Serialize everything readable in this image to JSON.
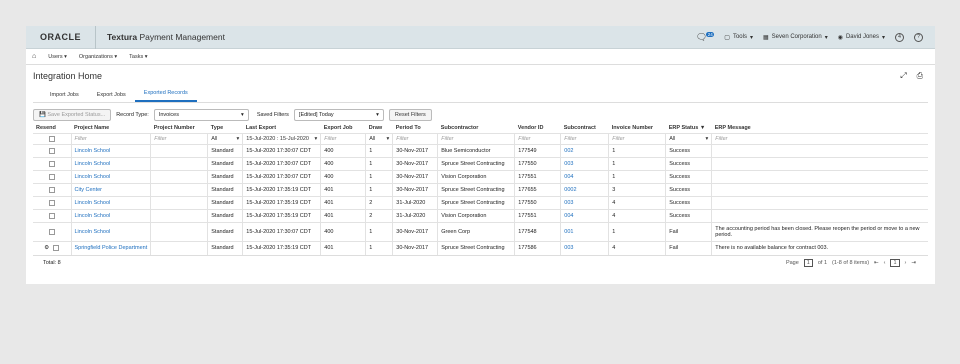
{
  "topbar": {
    "logo": "ORACLE",
    "app_name_bold": "Textura",
    "app_name_rest": " Payment Management",
    "notif_count": "24",
    "tools": "Tools",
    "company": "Seven Corporation",
    "user": "David Jones",
    "bell_count": "4",
    "help": "?"
  },
  "menubar": {
    "users": "Users",
    "organizations": "Organizations",
    "tasks": "Tasks"
  },
  "page": {
    "title": "Integration Home"
  },
  "tabs": [
    {
      "label": "Import Jobs"
    },
    {
      "label": "Export Jobs"
    },
    {
      "label": "Exported Records"
    }
  ],
  "toolbar": {
    "save_status": "Save Exported Status...",
    "record_type_label": "Record Type:",
    "record_type_value": "Invoices",
    "saved_filters_label": "Saved Filters",
    "saved_filters_value": "[Edited] Today",
    "reset_filters": "Reset Filters"
  },
  "table": {
    "headers": [
      "Resend",
      "Project Name",
      "Project Number",
      "Type",
      "Last Export",
      "Export Job",
      "Draw",
      "Period To",
      "Subcontractor",
      "Vendor ID",
      "Subcontract",
      "Invoice Number",
      "ERP Status",
      "ERP Message"
    ],
    "filter_placeholder": "Filter",
    "filter_all": "All",
    "filter_date": "15-Jul-2020 : 15-Jul-2020",
    "rows": [
      [
        "Lincoln School",
        "",
        "Standard",
        "15-Jul-2020 17:30:07 CDT",
        "400",
        "1",
        "30-Nov-2017",
        "Blue Semiconductor",
        "177549",
        "002",
        "1",
        "Success",
        ""
      ],
      [
        "Lincoln School",
        "",
        "Standard",
        "15-Jul-2020 17:30:07 CDT",
        "400",
        "1",
        "30-Nov-2017",
        "Spruce Street Contracting",
        "177550",
        "003",
        "1",
        "Success",
        ""
      ],
      [
        "Lincoln School",
        "",
        "Standard",
        "15-Jul-2020 17:30:07 CDT",
        "400",
        "1",
        "30-Nov-2017",
        "Vision Corporation",
        "177551",
        "004",
        "1",
        "Success",
        ""
      ],
      [
        "City Center",
        "",
        "Standard",
        "15-Jul-2020 17:35:19 CDT",
        "401",
        "1",
        "30-Nov-2017",
        "Spruce Street Contracting",
        "177655",
        "0002",
        "3",
        "Success",
        ""
      ],
      [
        "Lincoln School",
        "",
        "Standard",
        "15-Jul-2020 17:35:19 CDT",
        "401",
        "2",
        "31-Jul-2020",
        "Spruce Street Contracting",
        "177550",
        "003",
        "4",
        "Success",
        ""
      ],
      [
        "Lincoln School",
        "",
        "Standard",
        "15-Jul-2020 17:35:19 CDT",
        "401",
        "2",
        "31-Jul-2020",
        "Vision Corporation",
        "177551",
        "004",
        "4",
        "Success",
        ""
      ],
      [
        "Lincoln School",
        "",
        "Standard",
        "15-Jul-2020 17:30:07 CDT",
        "400",
        "1",
        "30-Nov-2017",
        "Green Corp",
        "177548",
        "001",
        "1",
        "Fail",
        "The accounting period has been closed. Please reopen the period or move to a new period."
      ],
      [
        "Springfield Police Department",
        "",
        "Standard",
        "15-Jul-2020 17:35:19 CDT",
        "401",
        "1",
        "30-Nov-2017",
        "Spruce Street Contracting",
        "177586",
        "003",
        "4",
        "Fail",
        "There is no available balance for contract 003."
      ]
    ]
  },
  "footer": {
    "total": "Total: 8",
    "page_label": "Page",
    "page_num": "1",
    "page_of": "of 1",
    "items_range": "(1-8 of 8 items)",
    "current_page": "1"
  }
}
